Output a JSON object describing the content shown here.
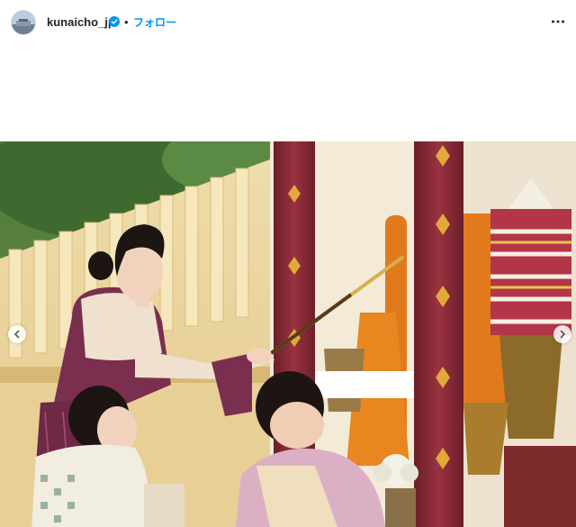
{
  "post": {
    "username": "kunaicho_jp",
    "separator": "•",
    "follow_label": "フォロー",
    "verified": true,
    "more_icon": "more-options-icon"
  },
  "media": {
    "description_icon": "photo",
    "prev_icon": "chevron-left-icon",
    "next_icon": "chevron-right-icon"
  },
  "colors": {
    "follow": "#0095f6",
    "verified": "#0095f6",
    "text": "#262626"
  }
}
